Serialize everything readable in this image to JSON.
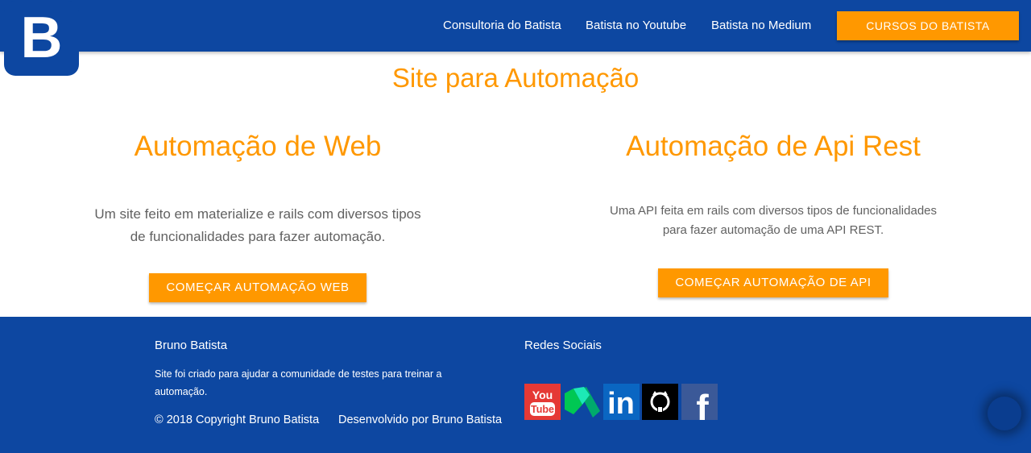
{
  "logo": {
    "letter": "B",
    "icon": "brand-b-logo"
  },
  "nav": {
    "links": [
      "Consultoria do Batista",
      "Batista no Youtube",
      "Batista no Medium"
    ],
    "cta": "CURSOS DO BATISTA"
  },
  "main": {
    "title": "Site para Automação",
    "cards": [
      {
        "title": "Automação de Web",
        "desc_lines": [
          "Um site feito em materialize e rails com diversos tipos",
          "de funcionalidades para fazer automação."
        ],
        "button": "COMEÇAR AUTOMAÇÃO WEB"
      },
      {
        "title": "Automação de Api Rest",
        "desc_lines": [
          "Uma API feita em rails com diversos tipos de funcionalidades",
          "para fazer automação de uma API REST."
        ],
        "button": "COMEÇAR AUTOMAÇÃO DE API"
      }
    ]
  },
  "footer": {
    "about_title": "Bruno Batista",
    "about_text": "Site foi criado para ajudar a comunidade de testes para treinar a automação.",
    "copyright": "© 2018 Copyright Bruno Batista",
    "developed": "Desenvolvido por Bruno Batista",
    "social_title": "Redes Sociais",
    "social": [
      {
        "name": "youtube",
        "icon": "youtube-icon",
        "label_top": "You",
        "label_bottom": "Tube"
      },
      {
        "name": "medium",
        "icon": "medium-icon"
      },
      {
        "name": "linkedin",
        "icon": "linkedin-icon",
        "label": "in"
      },
      {
        "name": "github",
        "icon": "github-icon"
      },
      {
        "name": "facebook",
        "icon": "facebook-icon",
        "label": "f"
      }
    ]
  },
  "colors": {
    "primary": "#0d47a1",
    "accent": "#ff9800"
  }
}
